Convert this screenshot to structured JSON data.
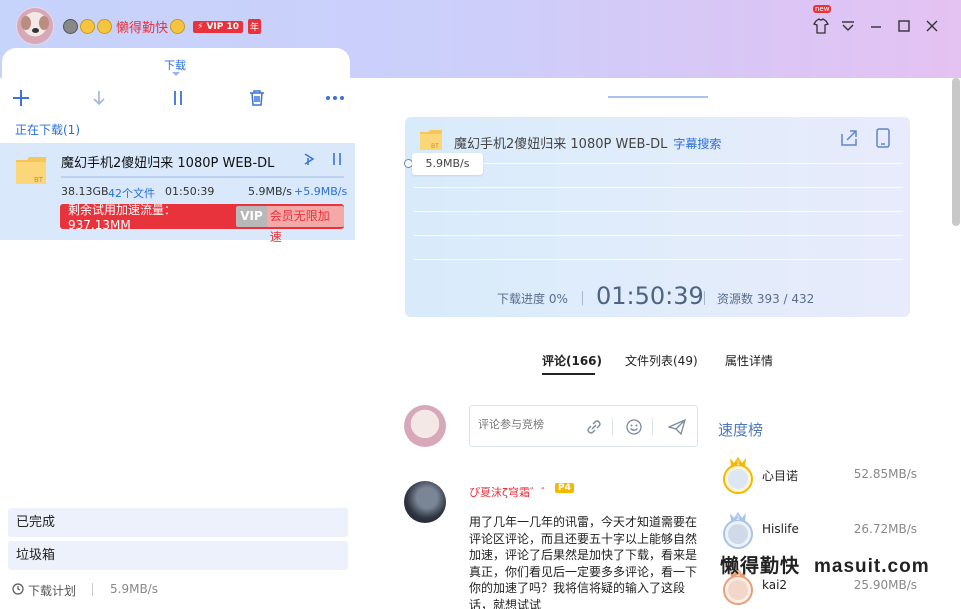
{
  "titlebar": {
    "username": "懒得勤快",
    "vip_label": "VIP 10",
    "year_label": "年",
    "skin_badge": "new"
  },
  "left": {
    "tab_label": "下载",
    "section_title": "正在下载(1)",
    "task": {
      "name": "魔幻手机2傻妞归来 1080P WEB-DL",
      "size": "38.13GB",
      "files": "42个文件",
      "remaining_time": "01:50:39",
      "speed": "5.9MB/s",
      "accel_speed": "+5.9MB/s",
      "progress": 0,
      "accel_text": "剩余试用加速流量：937.13MM",
      "accel_vip": "VIP",
      "accel_member": "会员无限加速",
      "bt_label": "BT"
    },
    "nav": [
      {
        "label": "已完成"
      },
      {
        "label": "垃圾箱"
      }
    ],
    "bottom": {
      "plan_label": "下载计划",
      "speed": "5.9MB/s"
    }
  },
  "detail": {
    "title": "魔幻手机2傻妞归来 1080P WEB-DL",
    "subtitle_search": "字幕搜索",
    "speed_chip": "5.9MB/s",
    "progress_label": "下载进度 0%",
    "time": "01:50:39",
    "sources": "资源数 393 / 432",
    "bt_label": "BT",
    "tabs": [
      {
        "label": "评论(166)"
      },
      {
        "label": "文件列表(49)"
      },
      {
        "label": "属性详情"
      }
    ]
  },
  "comments": {
    "input_placeholder": "评论参与竞榜",
    "items": [
      {
        "user": "ぴ夏沫ζ穹霜゛゛",
        "level": "P4",
        "text": "用了几年一几年的讯雷，今天才知道需要在评论区评论，而且还要五十字以上能够自然加速，评论了后果然是加快了下载，看来是真正，你们看见后一定要多多评论，看一下你的加速了吗？我将信将疑的输入了这段话，就想试试"
      }
    ]
  },
  "ranking": {
    "title": "速度榜",
    "rows": [
      {
        "rank": "1",
        "name": "心目诺",
        "speed": "52.85MB/s"
      },
      {
        "rank": "2",
        "name": "Hislife",
        "speed": "26.72MB/s"
      },
      {
        "rank": "3",
        "name": "kai2",
        "speed": "25.90MB/s"
      }
    ]
  },
  "watermark": {
    "cn": "懒得勤快",
    "en": "masuit.com"
  },
  "colors": {
    "accent": "#2a6fd8",
    "red": "#e8323c",
    "task_bg": "#d9e9fb"
  }
}
